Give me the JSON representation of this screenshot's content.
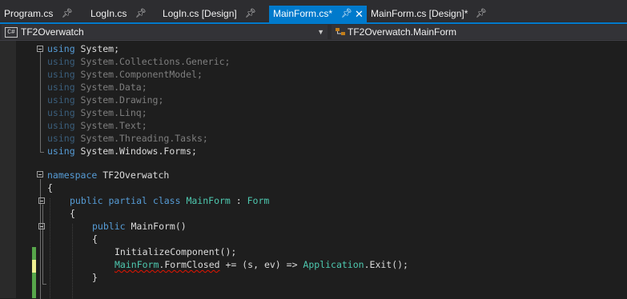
{
  "tabs": [
    {
      "label": "Program.cs",
      "pinned": true,
      "active": false
    },
    {
      "label": "LogIn.cs",
      "pinned": true,
      "active": false
    },
    {
      "label": "LogIn.cs [Design]",
      "pinned": true,
      "active": false
    },
    {
      "label": "MainForm.cs*",
      "pinned": true,
      "active": true
    },
    {
      "label": "MainForm.cs [Design]*",
      "pinned": true,
      "active": false
    }
  ],
  "navbar": {
    "project": "TF2Overwatch",
    "project_badge": "C#",
    "member": "TF2Overwatch.MainForm"
  },
  "colors": {
    "keyword": "#569cd6",
    "type": "#4ec9b0",
    "text": "#dcdcdc",
    "accent": "#007acc",
    "saved_change": "#57a64a",
    "unsaved_change": "#efef91"
  },
  "code": {
    "l1_kw": "using",
    "l1_rest": " System;",
    "l2_kw": "using",
    "l2_rest": " System.Collections.Generic;",
    "l3_kw": "using",
    "l3_rest": " System.ComponentModel;",
    "l4_kw": "using",
    "l4_rest": " System.Data;",
    "l5_kw": "using",
    "l5_rest": " System.Drawing;",
    "l6_kw": "using",
    "l6_rest": " System.Linq;",
    "l7_kw": "using",
    "l7_rest": " System.Text;",
    "l8_kw": "using",
    "l8_rest": " System.Threading.Tasks;",
    "l9_kw": "using",
    "l9_rest": " System.Windows.Forms;",
    "l11_kw": "namespace",
    "l11_rest": " TF2Overwatch",
    "l12": "{",
    "l13_kw1": "public",
    "l13_kw2": "partial",
    "l13_kw3": "class",
    "l13_name": "MainForm",
    "l13_colon": " : ",
    "l13_base": "Form",
    "l14": "{",
    "l15_kw": "public",
    "l15_rest": " MainForm()",
    "l16": "{",
    "l17": "InitializeComponent();",
    "l18_type": "MainForm",
    "l18_member": ".FormClosed",
    "l18_rest": " += (s, ev) => ",
    "l18_app": "Application",
    "l18_end": ".Exit();",
    "l19": "}"
  }
}
